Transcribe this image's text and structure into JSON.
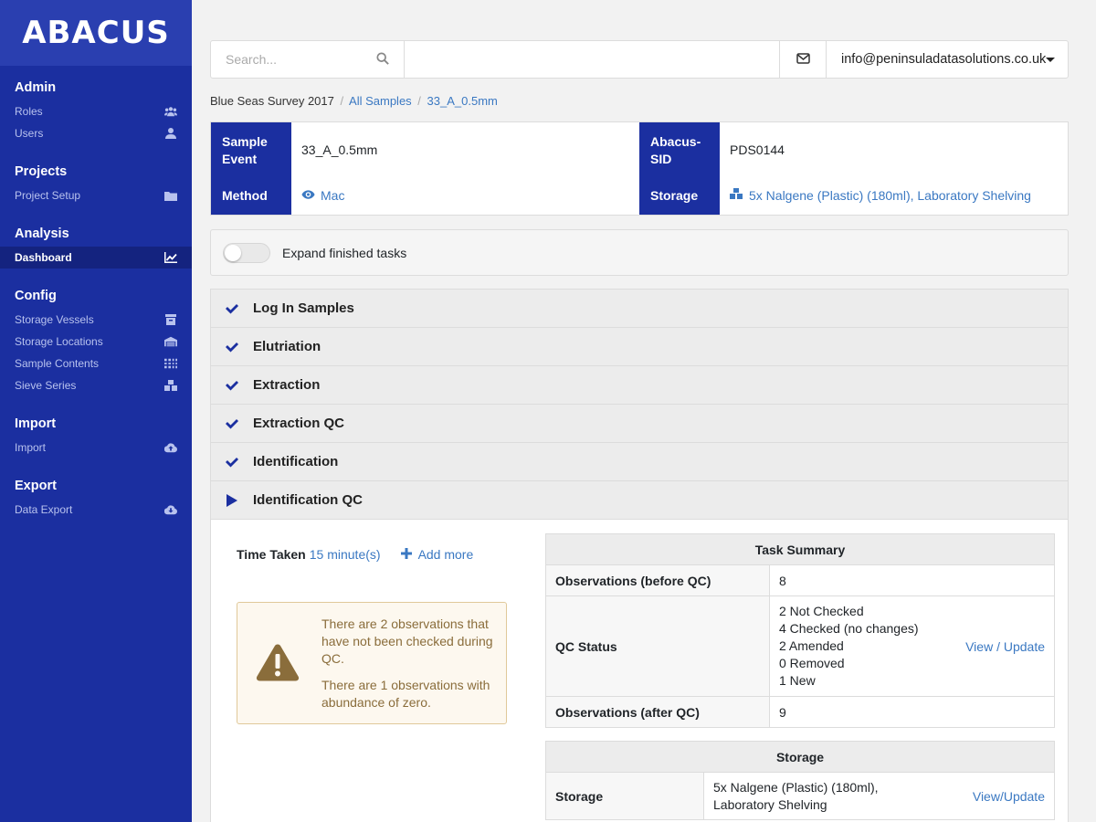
{
  "sidebar": {
    "brand": "ABACUS",
    "sections": [
      {
        "title": "Admin",
        "items": [
          {
            "label": "Roles",
            "icon": "users-group-icon"
          },
          {
            "label": "Users",
            "icon": "user-icon"
          }
        ]
      },
      {
        "title": "Projects",
        "items": [
          {
            "label": "Project Setup",
            "icon": "folder-icon"
          }
        ]
      },
      {
        "title": "Analysis",
        "items": [
          {
            "label": "Dashboard",
            "icon": "chart-line-icon",
            "active": true
          }
        ]
      },
      {
        "title": "Config",
        "items": [
          {
            "label": "Storage Vessels",
            "icon": "archive-icon"
          },
          {
            "label": "Storage Locations",
            "icon": "warehouse-icon"
          },
          {
            "label": "Sample Contents",
            "icon": "grid-icon"
          },
          {
            "label": "Sieve Series",
            "icon": "cubes-icon"
          }
        ]
      },
      {
        "title": "Import",
        "items": [
          {
            "label": "Import",
            "icon": "cloud-upload-icon"
          }
        ]
      },
      {
        "title": "Export",
        "items": [
          {
            "label": "Data Export",
            "icon": "cloud-download-icon"
          }
        ]
      }
    ]
  },
  "topbar": {
    "search_placeholder": "Search...",
    "user_email": "info@peninsuladatasolutions.co.uk"
  },
  "breadcrumb": {
    "project": "Blue Seas Survey 2017",
    "all_samples": "All Samples",
    "current": "33_A_0.5mm"
  },
  "sample": {
    "event_label": "Sample Event",
    "event_value": "33_A_0.5mm",
    "method_label": "Method",
    "method_value": "Mac",
    "sid_label": "Abacus-SID",
    "sid_value": "PDS0144",
    "storage_label": "Storage",
    "storage_value": "5x Nalgene (Plastic) (180ml), Laboratory Shelving"
  },
  "toggle": {
    "label": "Expand finished tasks",
    "on": false
  },
  "tasks": [
    {
      "label": "Log In Samples",
      "status": "done"
    },
    {
      "label": "Elutriation",
      "status": "done"
    },
    {
      "label": "Extraction",
      "status": "done"
    },
    {
      "label": "Extraction QC",
      "status": "done"
    },
    {
      "label": "Identification",
      "status": "done"
    },
    {
      "label": "Identification QC",
      "status": "current"
    }
  ],
  "detail": {
    "time_label": "Time Taken",
    "time_value": "15 minute(s)",
    "add_more": "Add more",
    "warnings": [
      "There are 2 observations that have not been checked during QC.",
      "There are 1 observations with abundance of zero."
    ],
    "summary": {
      "title": "Task Summary",
      "obs_before_label": "Observations (before QC)",
      "obs_before_value": "8",
      "qc_label": "QC Status",
      "qc_lines": [
        "2 Not Checked",
        "4 Checked (no changes)",
        "2 Amended",
        "0 Removed",
        "1 New"
      ],
      "qc_link": "View / Update",
      "obs_after_label": "Observations (after QC)",
      "obs_after_value": "9"
    },
    "storage": {
      "title": "Storage",
      "label": "Storage",
      "value": "5x Nalgene (Plastic) (180ml), Laboratory Shelving",
      "link": "View/Update"
    }
  }
}
